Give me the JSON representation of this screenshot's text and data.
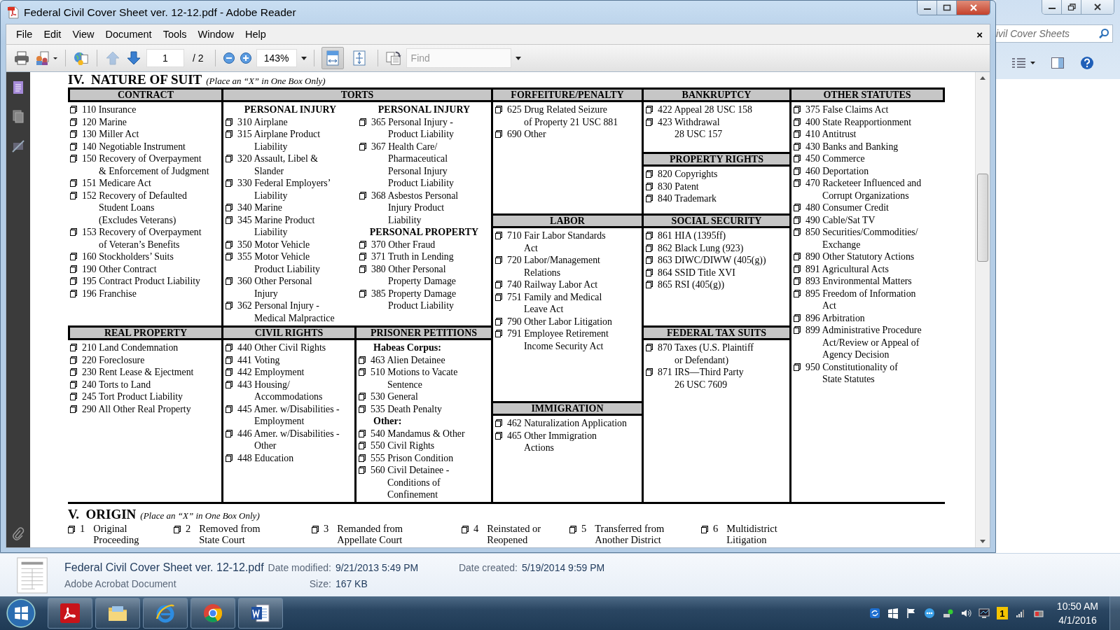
{
  "window": {
    "title": "Federal Civil Cover Sheet ver. 12-12.pdf - Adobe Reader"
  },
  "menu": [
    "File",
    "Edit",
    "View",
    "Document",
    "Tools",
    "Window",
    "Help"
  ],
  "menu_close": "×",
  "toolbar": {
    "page": "1",
    "page_total": "/ 2",
    "zoom": "143%",
    "find_placeholder": "Find",
    "page_nav": [
      {
        "kind": "previous",
        "disabled": true
      },
      {
        "kind": "next",
        "disabled": false
      }
    ],
    "view_buttons": [
      {
        "kind": "fit-width",
        "selected": true
      },
      {
        "kind": "fit-page",
        "selected": false
      }
    ]
  },
  "document": {
    "section_title": "IV.  NATURE OF SUIT",
    "section_note": "(Place an “X” in One Box Only)",
    "categories": [
      {
        "title": "CONTRACT",
        "columns": [
          [
            {
              "kind": "item",
              "lines": [
                "110 Insurance"
              ]
            },
            {
              "kind": "item",
              "lines": [
                "120 Marine"
              ]
            },
            {
              "kind": "item",
              "lines": [
                "130 Miller Act"
              ]
            },
            {
              "kind": "item",
              "lines": [
                "140 Negotiable Instrument"
              ]
            },
            {
              "kind": "item",
              "lines": [
                "150 Recovery of Overpayment",
                "& Enforcement of Judgment"
              ]
            },
            {
              "kind": "item",
              "lines": [
                "151 Medicare Act"
              ]
            },
            {
              "kind": "item",
              "lines": [
                "152 Recovery of Defaulted",
                "Student Loans",
                "(Excludes Veterans)"
              ]
            },
            {
              "kind": "item",
              "lines": [
                "153 Recovery of Overpayment",
                "of Veteran’s Benefits"
              ]
            },
            {
              "kind": "item",
              "lines": [
                "160 Stockholders’ Suits"
              ]
            },
            {
              "kind": "item",
              "lines": [
                "190 Other Contract"
              ]
            },
            {
              "kind": "item",
              "lines": [
                "195 Contract Product Liability"
              ]
            },
            {
              "kind": "item",
              "lines": [
                "196 Franchise"
              ]
            }
          ]
        ]
      },
      {
        "title": "TORTS",
        "columns": [
          [
            {
              "kind": "subheading",
              "text": "PERSONAL INJURY"
            },
            {
              "kind": "item",
              "lines": [
                "310 Airplane"
              ]
            },
            {
              "kind": "item",
              "lines": [
                "315 Airplane Product",
                "Liability"
              ]
            },
            {
              "kind": "item",
              "lines": [
                "320 Assault, Libel &",
                "Slander"
              ]
            },
            {
              "kind": "item",
              "lines": [
                "330 Federal Employers’",
                "Liability"
              ]
            },
            {
              "kind": "item",
              "lines": [
                "340 Marine"
              ]
            },
            {
              "kind": "item",
              "lines": [
                "345 Marine Product",
                "Liability"
              ]
            },
            {
              "kind": "item",
              "lines": [
                "350 Motor Vehicle"
              ]
            },
            {
              "kind": "item",
              "lines": [
                "355 Motor Vehicle",
                "Product Liability"
              ]
            },
            {
              "kind": "item",
              "lines": [
                "360 Other Personal",
                "Injury"
              ]
            },
            {
              "kind": "item",
              "lines": [
                "362 Personal Injury -",
                "Medical Malpractice"
              ]
            }
          ],
          [
            {
              "kind": "subheading",
              "text": "PERSONAL INJURY"
            },
            {
              "kind": "item",
              "lines": [
                "365 Personal Injury  -",
                "Product Liability"
              ]
            },
            {
              "kind": "item",
              "lines": [
                "367 Health Care/",
                "Pharmaceutical",
                "Personal Injury",
                "Product Liability"
              ]
            },
            {
              "kind": "item",
              "lines": [
                "368 Asbestos Personal",
                "Injury Product",
                "Liability"
              ]
            },
            {
              "kind": "subheading",
              "text": "PERSONAL PROPERTY"
            },
            {
              "kind": "item",
              "lines": [
                "370 Other Fraud"
              ]
            },
            {
              "kind": "item",
              "lines": [
                "371 Truth in Lending"
              ]
            },
            {
              "kind": "item",
              "lines": [
                "380 Other Personal",
                "Property Damage"
              ]
            },
            {
              "kind": "item",
              "lines": [
                "385 Property Damage",
                "Product Liability"
              ]
            }
          ]
        ]
      },
      {
        "title": "FORFEITURE/PENALTY",
        "columns": [
          [
            {
              "kind": "item",
              "lines": [
                "625 Drug Related Seizure",
                "of Property 21 USC 881"
              ]
            },
            {
              "kind": "item",
              "lines": [
                "690 Other"
              ]
            }
          ]
        ]
      },
      {
        "title": "BANKRUPTCY",
        "columns": [
          [
            {
              "kind": "item",
              "lines": [
                "422 Appeal 28 USC 158"
              ]
            },
            {
              "kind": "item",
              "lines": [
                "423 Withdrawal",
                "28 USC 157"
              ]
            }
          ]
        ]
      },
      {
        "title": "OTHER STATUTES",
        "columns": [
          [
            {
              "kind": "item",
              "lines": [
                "375 False Claims Act"
              ]
            },
            {
              "kind": "item",
              "lines": [
                "400 State Reapportionment"
              ]
            },
            {
              "kind": "item",
              "lines": [
                "410 Antitrust"
              ]
            },
            {
              "kind": "item",
              "lines": [
                "430 Banks and Banking"
              ]
            },
            {
              "kind": "item",
              "lines": [
                "450 Commerce"
              ]
            },
            {
              "kind": "item",
              "lines": [
                "460 Deportation"
              ]
            },
            {
              "kind": "item",
              "lines": [
                "470 Racketeer Influenced and",
                "Corrupt Organizations"
              ]
            },
            {
              "kind": "item",
              "lines": [
                "480 Consumer Credit"
              ]
            },
            {
              "kind": "item",
              "lines": [
                "490 Cable/Sat TV"
              ]
            },
            {
              "kind": "item",
              "lines": [
                "850 Securities/Commodities/",
                "Exchange"
              ]
            },
            {
              "kind": "item",
              "lines": [
                "890 Other Statutory Actions"
              ]
            },
            {
              "kind": "item",
              "lines": [
                "891 Agricultural Acts"
              ]
            },
            {
              "kind": "item",
              "lines": [
                "893 Environmental Matters"
              ]
            },
            {
              "kind": "item",
              "lines": [
                "895 Freedom of Information",
                "Act"
              ]
            },
            {
              "kind": "item",
              "lines": [
                "896 Arbitration"
              ]
            },
            {
              "kind": "item",
              "lines": [
                "899 Administrative Procedure",
                "Act/Review or Appeal of",
                "Agency Decision"
              ]
            },
            {
              "kind": "item",
              "lines": [
                "950 Constitutionality of",
                "State Statutes"
              ]
            }
          ]
        ]
      },
      {
        "title": "PROPERTY RIGHTS",
        "columns": [
          [
            {
              "kind": "item",
              "lines": [
                "820 Copyrights"
              ]
            },
            {
              "kind": "item",
              "lines": [
                "830 Patent"
              ]
            },
            {
              "kind": "item",
              "lines": [
                "840 Trademark"
              ]
            }
          ]
        ]
      },
      {
        "title": "LABOR",
        "columns": [
          [
            {
              "kind": "item",
              "lines": [
                "710 Fair Labor Standards",
                "Act"
              ]
            },
            {
              "kind": "item",
              "lines": [
                "720 Labor/Management",
                "Relations"
              ]
            },
            {
              "kind": "item",
              "lines": [
                "740 Railway Labor Act"
              ]
            },
            {
              "kind": "item",
              "lines": [
                "751 Family and Medical",
                "Leave Act"
              ]
            },
            {
              "kind": "item",
              "lines": [
                "790 Other Labor Litigation"
              ]
            },
            {
              "kind": "item",
              "lines": [
                "791 Employee Retirement",
                "Income Security Act"
              ]
            }
          ]
        ]
      },
      {
        "title": "SOCIAL SECURITY",
        "columns": [
          [
            {
              "kind": "item",
              "lines": [
                "861 HIA (1395ff)"
              ]
            },
            {
              "kind": "item",
              "lines": [
                "862 Black Lung (923)"
              ]
            },
            {
              "kind": "item",
              "lines": [
                "863 DIWC/DIWW (405(g))"
              ]
            },
            {
              "kind": "item",
              "lines": [
                "864 SSID Title XVI"
              ]
            },
            {
              "kind": "item",
              "lines": [
                "865 RSI (405(g))"
              ]
            }
          ]
        ]
      },
      {
        "title": "REAL PROPERTY",
        "columns": [
          [
            {
              "kind": "item",
              "lines": [
                "210 Land Condemnation"
              ]
            },
            {
              "kind": "item",
              "lines": [
                "220 Foreclosure"
              ]
            },
            {
              "kind": "item",
              "lines": [
                "230 Rent Lease & Ejectment"
              ]
            },
            {
              "kind": "item",
              "lines": [
                "240 Torts to Land"
              ]
            },
            {
              "kind": "item",
              "lines": [
                "245 Tort Product Liability"
              ]
            },
            {
              "kind": "item",
              "lines": [
                "290 All Other Real Property"
              ]
            }
          ]
        ]
      },
      {
        "title": "CIVIL RIGHTS",
        "columns": [
          [
            {
              "kind": "item",
              "lines": [
                "440 Other Civil Rights"
              ]
            },
            {
              "kind": "item",
              "lines": [
                "441 Voting"
              ]
            },
            {
              "kind": "item",
              "lines": [
                "442 Employment"
              ]
            },
            {
              "kind": "item",
              "lines": [
                "443 Housing/",
                "Accommodations"
              ]
            },
            {
              "kind": "item",
              "lines": [
                "445 Amer. w/Disabilities -",
                "Employment"
              ]
            },
            {
              "kind": "item",
              "lines": [
                "446 Amer. w/Disabilities -",
                "Other"
              ]
            },
            {
              "kind": "item",
              "lines": [
                "448 Education"
              ]
            }
          ]
        ]
      },
      {
        "title": "PRISONER PETITIONS",
        "columns": [
          [
            {
              "kind": "subheading",
              "text": "Habeas Corpus:"
            },
            {
              "kind": "item",
              "lines": [
                "463 Alien Detainee"
              ]
            },
            {
              "kind": "item",
              "lines": [
                "510 Motions to Vacate",
                "Sentence"
              ]
            },
            {
              "kind": "item",
              "lines": [
                "530 General"
              ]
            },
            {
              "kind": "item",
              "lines": [
                "535 Death Penalty"
              ]
            },
            {
              "kind": "subheading",
              "text": "Other:"
            },
            {
              "kind": "item",
              "lines": [
                "540 Mandamus & Other"
              ]
            },
            {
              "kind": "item",
              "lines": [
                "550 Civil Rights"
              ]
            },
            {
              "kind": "item",
              "lines": [
                "555 Prison Condition"
              ]
            },
            {
              "kind": "item",
              "lines": [
                "560 Civil Detainee -",
                "Conditions of",
                "Confinement"
              ]
            }
          ]
        ]
      },
      {
        "title": "FEDERAL TAX SUITS",
        "columns": [
          [
            {
              "kind": "item",
              "lines": [
                "870 Taxes (U.S. Plaintiff",
                "or Defendant)"
              ]
            },
            {
              "kind": "item",
              "lines": [
                "871 IRS—Third Party",
                "26 USC 7609"
              ]
            }
          ]
        ]
      },
      {
        "title": "IMMIGRATION",
        "columns": [
          [
            {
              "kind": "item",
              "lines": [
                "462 Naturalization Application"
              ]
            },
            {
              "kind": "item",
              "lines": [
                "465 Other Immigration",
                "Actions"
              ]
            }
          ]
        ]
      }
    ],
    "origin": {
      "title": "V.  ORIGIN",
      "note": "(Place an “X” in One Box Only)",
      "options": [
        {
          "number": "1",
          "lines": [
            "Original",
            "Proceeding"
          ]
        },
        {
          "number": "2",
          "lines": [
            "Removed from",
            "State Court"
          ]
        },
        {
          "number": "3",
          "lines": [
            "Remanded from",
            "Appellate Court"
          ]
        },
        {
          "number": "4",
          "lines": [
            "Reinstated or",
            "Reopened"
          ]
        },
        {
          "number": "5",
          "lines": [
            "Transferred from",
            "Another District"
          ]
        },
        {
          "number": "6",
          "lines": [
            "Multidistrict",
            "Litigation"
          ]
        }
      ]
    }
  },
  "explorer": {
    "search": "ivil Cover Sheets",
    "details": {
      "name": "Federal Civil Cover Sheet ver. 12-12.pdf",
      "type": "Adobe Acrobat Document",
      "fields": [
        {
          "label": "Date modified:",
          "value": "9/21/2013 5:49 PM"
        },
        {
          "label": "Date created:",
          "value": "5/19/2014 9:59 PM"
        },
        {
          "label": "Size:",
          "value": "167 KB"
        }
      ]
    }
  },
  "taskbar": {
    "apps": [
      {
        "kind": "acrobat"
      },
      {
        "kind": "folder"
      },
      {
        "kind": "ie"
      },
      {
        "kind": "chrome"
      },
      {
        "kind": "word"
      }
    ],
    "tray_badge": "1",
    "time": "10:50 AM",
    "date": "4/1/2016"
  }
}
